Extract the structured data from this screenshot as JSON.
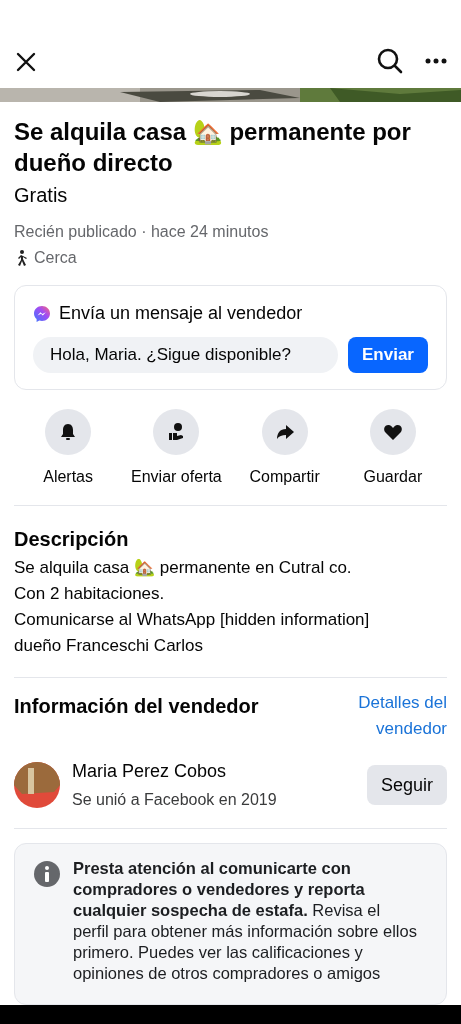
{
  "listing": {
    "title": "Se alquila casa 🏡 permanente por dueño directo",
    "price": "Gratis",
    "posted": "Recién publicado · hace 24 minutos",
    "distance": "Cerca"
  },
  "message_card": {
    "title": "Envía un mensaje al vendedor",
    "message": "Hola, Maria. ¿Sigue disponible?",
    "send_button": "Enviar"
  },
  "actions": [
    {
      "kind": "bell",
      "label": "Alertas"
    },
    {
      "kind": "offer",
      "label": "Enviar oferta"
    },
    {
      "kind": "share",
      "label": "Compartir"
    },
    {
      "kind": "heart",
      "label": "Guardar"
    }
  ],
  "description": {
    "heading": "Descripción",
    "lines": [
      "Se alquila casa 🏡 permanente en Cutral co.",
      "Con 2 habitaciones.",
      "Comunicarse al WhatsApp [hidden information]",
      "dueño Franceschi Carlos"
    ]
  },
  "seller": {
    "heading": "Información del vendedor",
    "details_link": "Detalles del vendedor",
    "name": "Maria Perez Cobos",
    "joined": "Se unió a Facebook en 2019",
    "follow_button": "Seguir"
  },
  "safety_notice": "**Presta atención al comunicarte con compradores o vendedores y reporta cualquier sospecha de estafa.** Revisa el perfil para obtener más información sobre ellos primero. Puedes ver las calificaciones y opiniones de otros compradores o amigos"
}
